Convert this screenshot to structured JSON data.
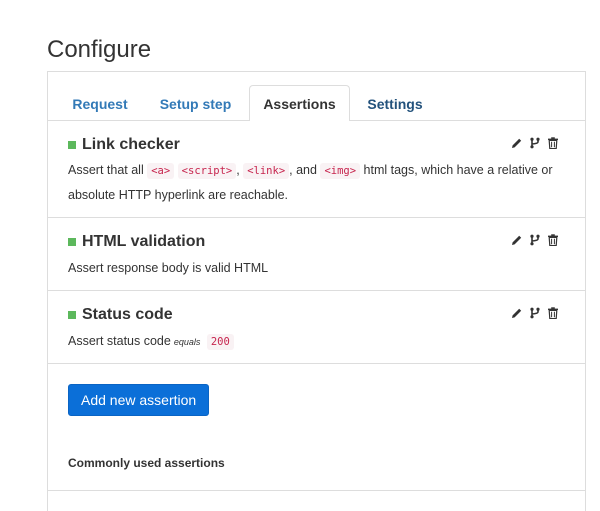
{
  "page": {
    "title": "Configure"
  },
  "tabs": [
    {
      "label": "Request",
      "active": false
    },
    {
      "label": "Setup step",
      "active": false
    },
    {
      "label": "Assertions",
      "active": true
    },
    {
      "label": "Settings",
      "active": false
    }
  ],
  "assertions": [
    {
      "title": "Link checker",
      "desc_prefix": "Assert that all",
      "codes": [
        "<a>",
        "<script>",
        "<link>",
        "<img>"
      ],
      "sep": ",",
      "and": ", and",
      "desc_suffix": "html tags, which have a relative or absolute HTTP hyperlink are reachable."
    },
    {
      "title": "HTML validation",
      "desc": "Assert response body is valid HTML"
    },
    {
      "title": "Status code",
      "desc_prefix": "Assert status code",
      "operator": "equals",
      "value": "200"
    }
  ],
  "icons": {
    "edit": "pencil-icon",
    "branch": "code-fork-icon",
    "delete": "trash-icon"
  },
  "colors": {
    "status": "#5cb85c",
    "primary": "#0b6fd8",
    "link": "#337ab7"
  },
  "add_button": {
    "label": "Add new assertion"
  },
  "common": {
    "label": "Commonly used assertions"
  }
}
